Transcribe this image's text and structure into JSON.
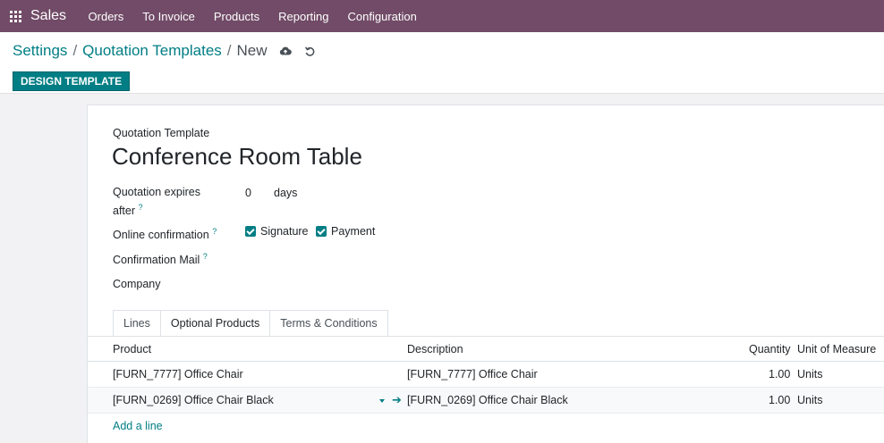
{
  "navbar": {
    "app_name": "Sales",
    "menu": [
      "Orders",
      "To Invoice",
      "Products",
      "Reporting",
      "Configuration"
    ]
  },
  "breadcrumb": {
    "items": [
      "Settings",
      "Quotation Templates"
    ],
    "current": "New",
    "save_icon": "cloud-upload-icon",
    "discard_icon": "undo-icon"
  },
  "actions": {
    "design_template": "DESIGN TEMPLATE"
  },
  "form": {
    "label": "Quotation Template",
    "name": "Conference Room Table",
    "expires_label_1": "Quotation expires",
    "expires_label_2": "after",
    "expires_value": "0",
    "expires_unit": "days",
    "online_confirmation_label": "Online confirmation",
    "signature_label": "Signature",
    "payment_label": "Payment",
    "confirmation_mail_label": "Confirmation Mail",
    "company_label": "Company",
    "help_mark": "?"
  },
  "tabs": [
    {
      "label": "Lines"
    },
    {
      "label": "Optional Products"
    },
    {
      "label": "Terms & Conditions"
    }
  ],
  "table": {
    "headers": {
      "product": "Product",
      "description": "Description",
      "quantity": "Quantity",
      "uom": "Unit of Measure"
    },
    "rows": [
      {
        "product": "[FURN_7777] Office Chair",
        "description": "[FURN_7777] Office Chair",
        "quantity": "1.00",
        "uom": "Units"
      },
      {
        "product": "[FURN_0269] Office Chair Black",
        "description": "[FURN_0269] Office Chair Black",
        "quantity": "1.00",
        "uom": "Units"
      }
    ],
    "add_line": "Add a line"
  },
  "colors": {
    "navbar": "#714b67",
    "primary": "#017e84"
  }
}
